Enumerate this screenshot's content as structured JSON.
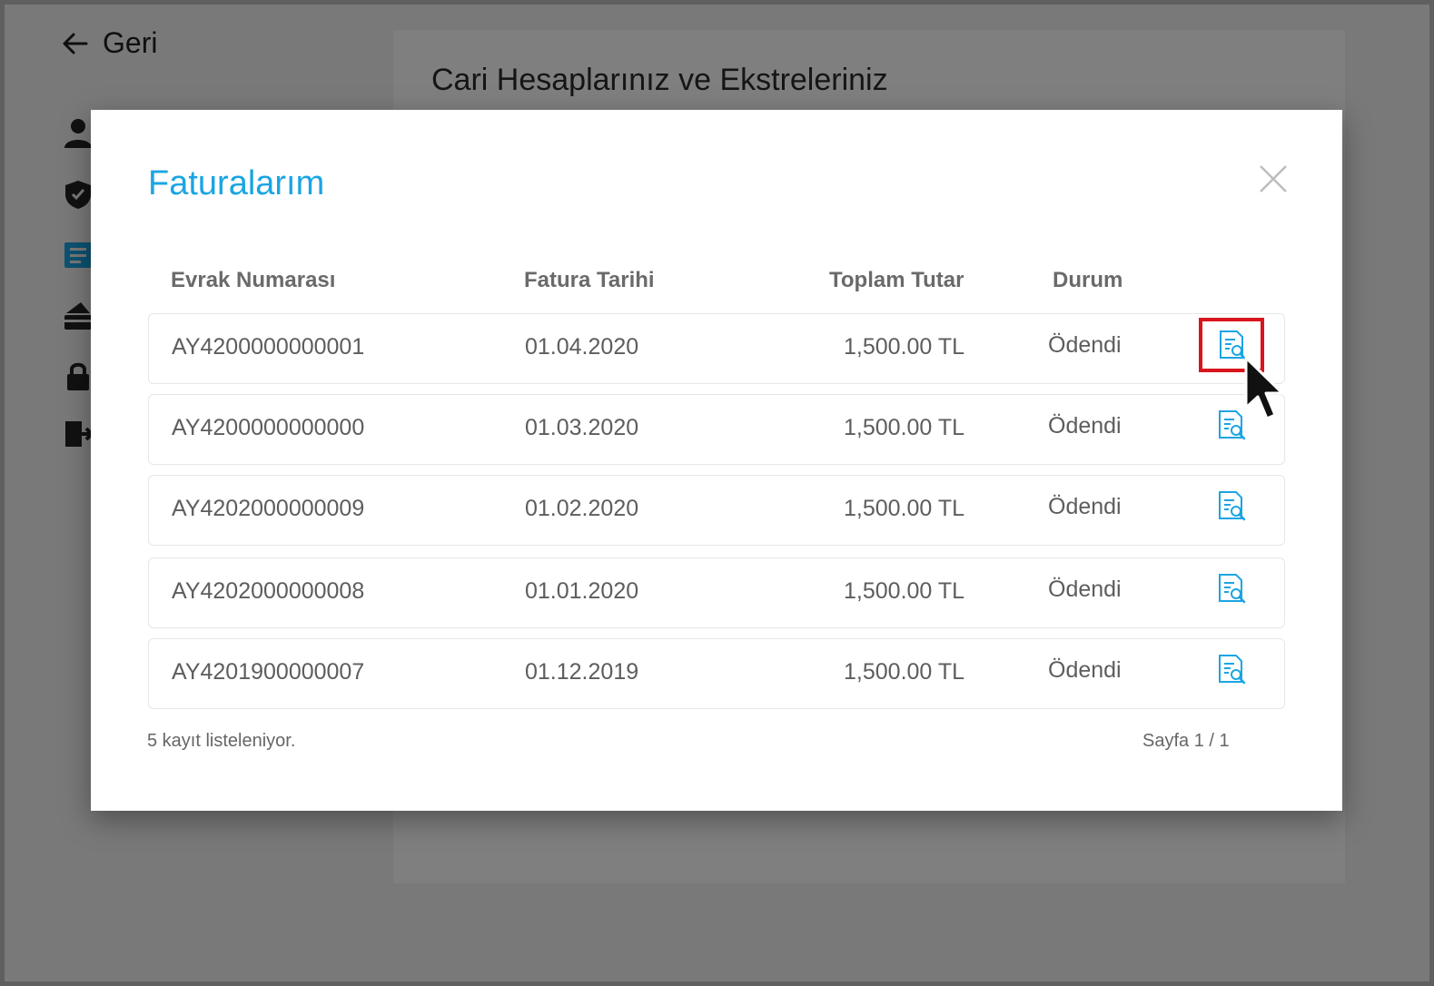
{
  "background": {
    "back_label": "Geri",
    "page_title": "Cari Hesaplarınız ve Ekstreleriniz",
    "sidebar_icons": [
      "user-icon",
      "shield-icon",
      "invoice-icon",
      "card-icon",
      "lock-icon",
      "logout-icon"
    ]
  },
  "modal": {
    "title": "Faturalarım",
    "columns": {
      "doc_no": "Evrak Numarası",
      "date": "Fatura Tarihi",
      "total": "Toplam Tutar",
      "status": "Durum"
    },
    "rows": [
      {
        "doc_no": "AY4200000000001",
        "date": "01.04.2020",
        "total": "1,500.00 TL",
        "status": "Ödendi"
      },
      {
        "doc_no": "AY4200000000000",
        "date": "01.03.2020",
        "total": "1,500.00 TL",
        "status": "Ödendi"
      },
      {
        "doc_no": "AY4202000000009",
        "date": "01.02.2020",
        "total": "1,500.00 TL",
        "status": "Ödendi"
      },
      {
        "doc_no": "AY4202000000008",
        "date": "01.01.2020",
        "total": "1,500.00 TL",
        "status": "Ödendi"
      },
      {
        "doc_no": "AY4201900000007",
        "date": "01.12.2019",
        "total": "1,500.00 TL",
        "status": "Ödendi"
      }
    ],
    "record_count": "5 kayıt listeleniyor.",
    "pagination": "Sayfa 1 / 1"
  },
  "colors": {
    "accent": "#1ba5e3",
    "highlight": "#d8161c"
  }
}
